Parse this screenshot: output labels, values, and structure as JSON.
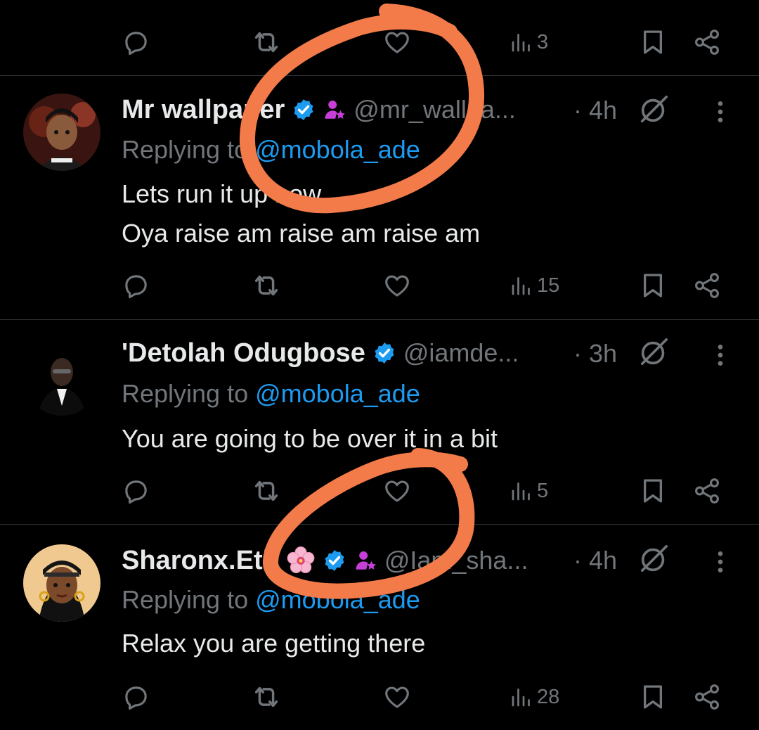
{
  "top_actions": {
    "views": "3"
  },
  "tweets": [
    {
      "name": "Mr wallpaper",
      "handle": "@mr_wallpa...",
      "time": "· 4h",
      "reply_prefix": "Replying to",
      "reply_to": "@mobola_ade",
      "text_lines": [
        "Lets run it up now",
        "Oya raise am raise am raise am"
      ],
      "views": "15",
      "badges": [
        "verified-badge",
        "affiliate-badge"
      ],
      "avatar_colors": [
        "#3a1410",
        "#1b1b1b",
        "#d9553a"
      ]
    },
    {
      "name": "'Detolah Odugbose",
      "handle": "@iamde...",
      "time": "· 3h",
      "reply_prefix": "Replying to",
      "reply_to": "@mobola_ade",
      "text_lines": [
        "You are going to be over it in a bit"
      ],
      "views": "5",
      "badges": [
        "verified-badge"
      ],
      "avatar_colors": [
        "#000000",
        "#ffffff"
      ]
    },
    {
      "name": "Sharonx.Eth",
      "handle": "@Iam_sha...",
      "time": "· 4h",
      "reply_prefix": "Replying to",
      "reply_to": "@mobola_ade",
      "text_lines": [
        "Relax you are getting there"
      ],
      "views": "28",
      "badges": [
        "blossom-emoji",
        "verified-badge",
        "affiliate-badge"
      ],
      "avatar_colors": [
        "#f0c990",
        "#7a4a2a",
        "#111111"
      ]
    }
  ],
  "colors": {
    "background": "#000000",
    "text_primary": "#e7e9ea",
    "text_secondary": "#71767b",
    "accent": "#1d9bf0",
    "affiliate": "#c640d8",
    "annotation": "#f37b4a"
  }
}
